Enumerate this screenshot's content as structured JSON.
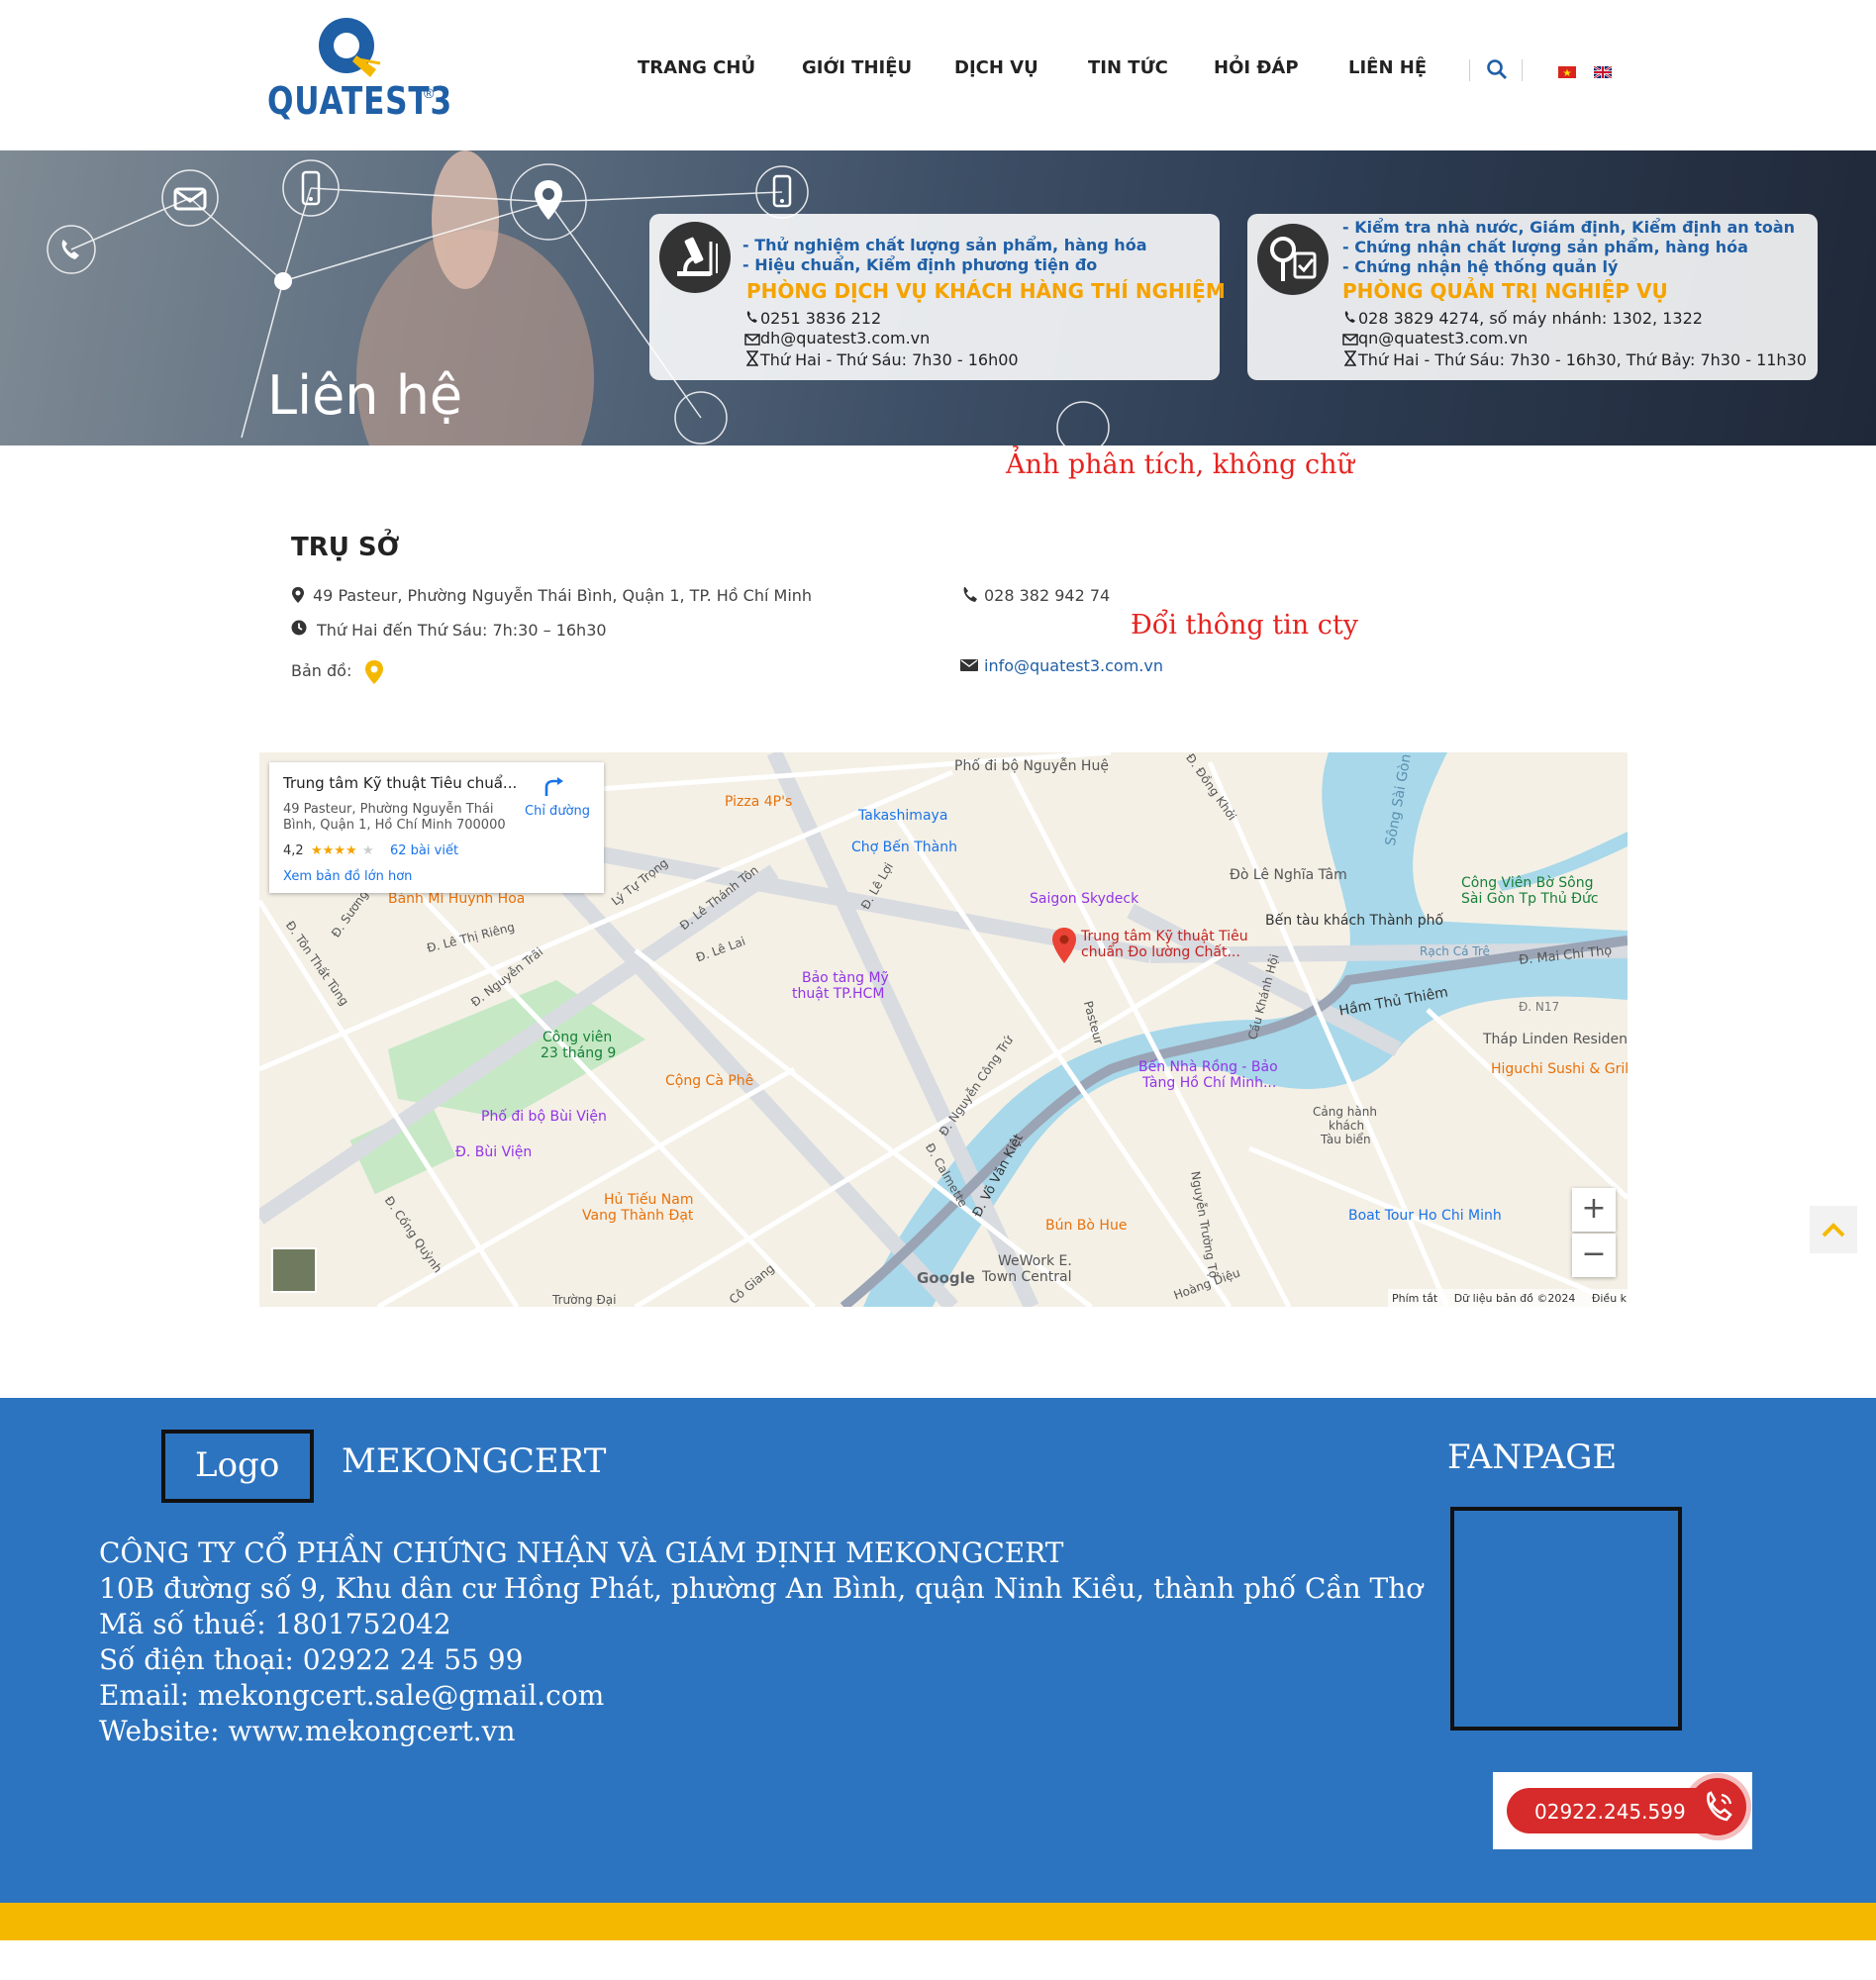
{
  "header": {
    "logo_text": "QUATEST3",
    "logo_reg": "®",
    "nav": [
      "TRANG CHỦ",
      "GIỚI THIỆU",
      "DỊCH VỤ",
      "TIN TỨC",
      "HỎI ĐÁP",
      "LIÊN HỆ"
    ],
    "search_icon": "search-icon",
    "flags": [
      "vietnam-flag",
      "uk-flag"
    ]
  },
  "banner": {
    "title": "Liên hệ",
    "card1": {
      "line1": "- Thử nghiệm chất lượng sản phẩm, hàng hóa",
      "line2": "- Hiệu chuẩn, Kiểm định phương tiện đo",
      "heading": "PHÒNG DỊCH VỤ KHÁCH HÀNG THÍ NGHIỆM",
      "phone": "0251 3836 212",
      "email": "dh@quatest3.com.vn",
      "hours": "Thứ Hai - Thứ Sáu: 7h30 - 16h00"
    },
    "card2": {
      "line1": "- Kiểm tra nhà nước, Giám định, Kiểm định an toàn",
      "line2": "- Chứng nhận chất lượng sản phẩm, hàng hóa",
      "line3": "- Chứng nhận hệ thống quản lý",
      "heading": "PHÒNG QUẢN TRỊ NGHIỆP VỤ",
      "phone": "028 3829 4274, số máy nhánh: 1302, 1322",
      "email": "qn@quatest3.com.vn",
      "hours": "Thứ Hai - Thứ Sáu: 7h30 - 16h30, Thứ Bảy: 7h30 - 11h30"
    }
  },
  "notes": {
    "banner_note": "Ảnh phân tích, không chữ",
    "info_note": "Đổi thông tin cty"
  },
  "office": {
    "title": "TRỤ SỞ",
    "address": "49 Pasteur, Phường Nguyễn Thái Bình, Quận 1, TP. Hồ Chí Minh",
    "hours": "Thứ Hai đến Thứ Sáu: 7h:30 – 16h30",
    "map_label": "Bản đồ:",
    "phone": "028 382 942 74",
    "email": "info@quatest3.com.vn"
  },
  "map": {
    "card_title": "Trung tâm Kỹ thuật Tiêu chuẩ...",
    "card_address1": "49 Pasteur, Phường Nguyễn Thái",
    "card_address2": "Bình, Quận 1, Hồ Chí Minh 700000",
    "rating": "4,2",
    "stars": "★★★★",
    "star_empty": "★",
    "reviews": "62 bài viết",
    "directions": "Chỉ đường",
    "larger_map": "Xem bản đồ lớn hơn",
    "marker_label1": "Trung tâm Kỹ thuật Tiêu",
    "marker_label2": "chuẩn Đo lường Chất...",
    "places": [
      "Phố đi bộ Nguyễn Huệ",
      "Takashimaya",
      "Chợ Bến Thành",
      "Pizza 4P's",
      "Saigon Skydeck",
      "Đò Lê Nghĩa Tâm",
      "Bến tàu khách Thành phố",
      "Công Viên Bờ Sông",
      "Sài Gòn Tp Thủ Đức",
      "Bánh Mì Huynh Hoa",
      "Bảo tàng Mỹ",
      "thuật TP.HCM",
      "Công viên",
      "23 tháng 9",
      "Cộng Cà Phê",
      "Phố đi bộ Bùi Viện",
      "Đ. Bùi Viện",
      "Hủ Tiếu Nam",
      "Vang Thành Đạt",
      "Bến Nhà Rồng - Bảo",
      "Tàng Hồ Chí Minh...",
      "Cảng hành",
      "khách",
      "Tàu biển",
      "Tháp Linden Residen",
      "Higuchi Sushi & Grill",
      "Bún Bò Hue",
      "WeWork E.",
      "Town Central",
      "Boat Tour Ho Chi Minh",
      "Hầm Thủ Thiêm",
      "Sông Sài Gòn",
      "Rạch Cá Trê",
      "Đ. Mai Chí Thọ",
      "Đ. N17",
      "Google"
    ],
    "streets": [
      "Lý Tự Trọng",
      "Đ. Lê Thánh Tôn",
      "Đ. Lê Lợi",
      "Đ. Lê Lai",
      "Đ. Lê Thị Riêng",
      "Đ. Nguyễn Trãi",
      "Đ. Sương",
      "Đ. Tôn Thất Tùng",
      "Đ. Cống Quỳnh",
      "Đ. Nguyễn Công Trứ",
      "Đ. Calmette",
      "Đ. Võ Văn Kiệt",
      "Pasteur",
      "Đ. Đồng Khởi",
      "Cầu Khánh Hội",
      "Nguyễn Trường Tộ",
      "Hoàng Diệu",
      "Cô Giang",
      "Trường Đại"
    ],
    "attribution": [
      "Phím tắt",
      "Dữ liệu bản đồ ©2024",
      "Điều khoản"
    ],
    "zoom_in": "+",
    "zoom_out": "−"
  },
  "footer": {
    "logo_placeholder": "Logo",
    "brand": "MEKONGCERT",
    "fanpage": "FANPAGE",
    "company": "CÔNG TY CỔ PHẦN CHỨNG NHẬN VÀ GIÁM ĐỊNH MEKONGCERT",
    "address": "10B đường số 9, Khu dân cư Hồng Phát, phường An Bình, quận Ninh Kiều, thành phố Cần Thơ",
    "tax": "Mã số thuế: 1801752042",
    "phone": "Số điện thoại: 02922 24 55 99",
    "email": "Email: mekongcert.sale@gmail.com",
    "website": "Website: www.mekongcert.vn",
    "hotline": "02922.245.599"
  },
  "colors": {
    "brand_blue": "#1f5fa6",
    "accent_orange": "#f5a300",
    "footer_blue": "#2d74c0",
    "footer_strip": "#f5b800",
    "note_red": "#e5231f",
    "call_red": "#d72a2a"
  }
}
